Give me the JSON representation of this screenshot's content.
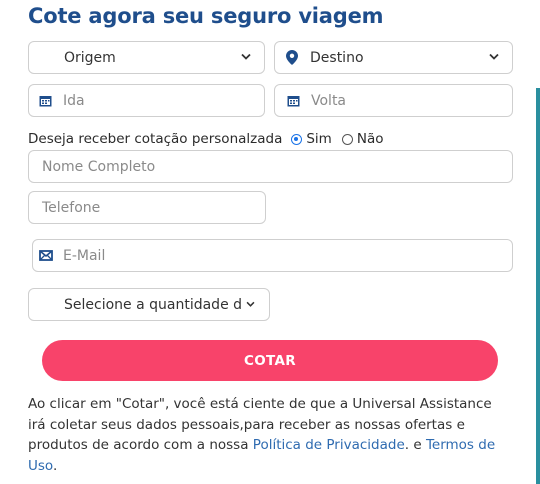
{
  "form": {
    "title": "Cote agora seu seguro viagem",
    "origin": {
      "value": "Origem"
    },
    "destination": {
      "value": "Destino"
    },
    "departure": {
      "placeholder": "Ida"
    },
    "return": {
      "placeholder": "Volta"
    },
    "quote_question": "Deseja receber cotação personalzada",
    "quote_options": [
      {
        "label": "Sim",
        "selected": true
      },
      {
        "label": "Não",
        "selected": false
      }
    ],
    "name": {
      "placeholder": "Nome Completo"
    },
    "phone": {
      "placeholder": "Telefone"
    },
    "email": {
      "placeholder": "E-Mail"
    },
    "quantity": {
      "value": "Selecione a quantidade d"
    },
    "submit_label": "COTAR"
  },
  "disclaimer": {
    "text_1": "Ao clicar em \"Cotar\", você está ciente de que a Universal Assistance irá coletar seus dados pessoais,para receber as nossas ofertas e produtos de acordo com a nossa ",
    "privacy_link": "Política de Privacidade",
    "text_2": ". e ",
    "terms_link": "Termos de Uso",
    "text_3": "."
  },
  "colors": {
    "title": "#1f4e8c",
    "accent": "#f8436a",
    "link": "#2f6bb0",
    "icon": "#1f4e8c",
    "radio_selected": "#1a73e8"
  }
}
